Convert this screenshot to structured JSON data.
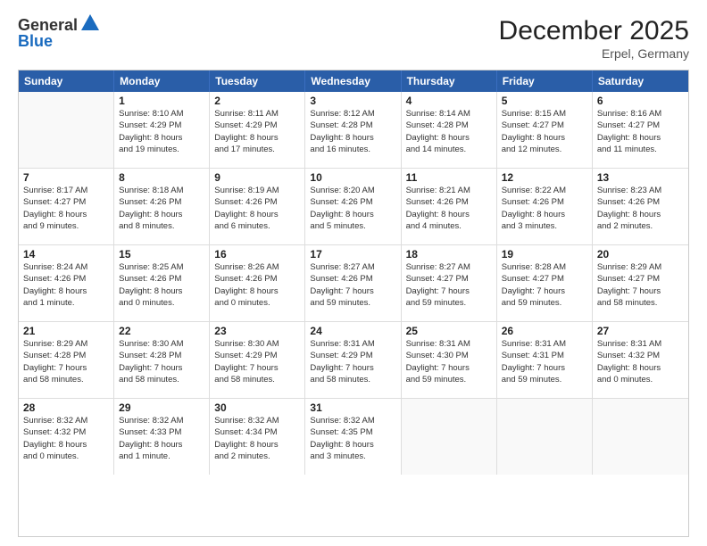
{
  "header": {
    "logo_general": "General",
    "logo_blue": "Blue",
    "month_title": "December 2025",
    "location": "Erpel, Germany"
  },
  "days_of_week": [
    "Sunday",
    "Monday",
    "Tuesday",
    "Wednesday",
    "Thursday",
    "Friday",
    "Saturday"
  ],
  "weeks": [
    [
      {
        "day": "",
        "info": ""
      },
      {
        "day": "1",
        "info": "Sunrise: 8:10 AM\nSunset: 4:29 PM\nDaylight: 8 hours\nand 19 minutes."
      },
      {
        "day": "2",
        "info": "Sunrise: 8:11 AM\nSunset: 4:29 PM\nDaylight: 8 hours\nand 17 minutes."
      },
      {
        "day": "3",
        "info": "Sunrise: 8:12 AM\nSunset: 4:28 PM\nDaylight: 8 hours\nand 16 minutes."
      },
      {
        "day": "4",
        "info": "Sunrise: 8:14 AM\nSunset: 4:28 PM\nDaylight: 8 hours\nand 14 minutes."
      },
      {
        "day": "5",
        "info": "Sunrise: 8:15 AM\nSunset: 4:27 PM\nDaylight: 8 hours\nand 12 minutes."
      },
      {
        "day": "6",
        "info": "Sunrise: 8:16 AM\nSunset: 4:27 PM\nDaylight: 8 hours\nand 11 minutes."
      }
    ],
    [
      {
        "day": "7",
        "info": "Sunrise: 8:17 AM\nSunset: 4:27 PM\nDaylight: 8 hours\nand 9 minutes."
      },
      {
        "day": "8",
        "info": "Sunrise: 8:18 AM\nSunset: 4:26 PM\nDaylight: 8 hours\nand 8 minutes."
      },
      {
        "day": "9",
        "info": "Sunrise: 8:19 AM\nSunset: 4:26 PM\nDaylight: 8 hours\nand 6 minutes."
      },
      {
        "day": "10",
        "info": "Sunrise: 8:20 AM\nSunset: 4:26 PM\nDaylight: 8 hours\nand 5 minutes."
      },
      {
        "day": "11",
        "info": "Sunrise: 8:21 AM\nSunset: 4:26 PM\nDaylight: 8 hours\nand 4 minutes."
      },
      {
        "day": "12",
        "info": "Sunrise: 8:22 AM\nSunset: 4:26 PM\nDaylight: 8 hours\nand 3 minutes."
      },
      {
        "day": "13",
        "info": "Sunrise: 8:23 AM\nSunset: 4:26 PM\nDaylight: 8 hours\nand 2 minutes."
      }
    ],
    [
      {
        "day": "14",
        "info": "Sunrise: 8:24 AM\nSunset: 4:26 PM\nDaylight: 8 hours\nand 1 minute."
      },
      {
        "day": "15",
        "info": "Sunrise: 8:25 AM\nSunset: 4:26 PM\nDaylight: 8 hours\nand 0 minutes."
      },
      {
        "day": "16",
        "info": "Sunrise: 8:26 AM\nSunset: 4:26 PM\nDaylight: 8 hours\nand 0 minutes."
      },
      {
        "day": "17",
        "info": "Sunrise: 8:27 AM\nSunset: 4:26 PM\nDaylight: 7 hours\nand 59 minutes."
      },
      {
        "day": "18",
        "info": "Sunrise: 8:27 AM\nSunset: 4:27 PM\nDaylight: 7 hours\nand 59 minutes."
      },
      {
        "day": "19",
        "info": "Sunrise: 8:28 AM\nSunset: 4:27 PM\nDaylight: 7 hours\nand 59 minutes."
      },
      {
        "day": "20",
        "info": "Sunrise: 8:29 AM\nSunset: 4:27 PM\nDaylight: 7 hours\nand 58 minutes."
      }
    ],
    [
      {
        "day": "21",
        "info": "Sunrise: 8:29 AM\nSunset: 4:28 PM\nDaylight: 7 hours\nand 58 minutes."
      },
      {
        "day": "22",
        "info": "Sunrise: 8:30 AM\nSunset: 4:28 PM\nDaylight: 7 hours\nand 58 minutes."
      },
      {
        "day": "23",
        "info": "Sunrise: 8:30 AM\nSunset: 4:29 PM\nDaylight: 7 hours\nand 58 minutes."
      },
      {
        "day": "24",
        "info": "Sunrise: 8:31 AM\nSunset: 4:29 PM\nDaylight: 7 hours\nand 58 minutes."
      },
      {
        "day": "25",
        "info": "Sunrise: 8:31 AM\nSunset: 4:30 PM\nDaylight: 7 hours\nand 59 minutes."
      },
      {
        "day": "26",
        "info": "Sunrise: 8:31 AM\nSunset: 4:31 PM\nDaylight: 7 hours\nand 59 minutes."
      },
      {
        "day": "27",
        "info": "Sunrise: 8:31 AM\nSunset: 4:32 PM\nDaylight: 8 hours\nand 0 minutes."
      }
    ],
    [
      {
        "day": "28",
        "info": "Sunrise: 8:32 AM\nSunset: 4:32 PM\nDaylight: 8 hours\nand 0 minutes."
      },
      {
        "day": "29",
        "info": "Sunrise: 8:32 AM\nSunset: 4:33 PM\nDaylight: 8 hours\nand 1 minute."
      },
      {
        "day": "30",
        "info": "Sunrise: 8:32 AM\nSunset: 4:34 PM\nDaylight: 8 hours\nand 2 minutes."
      },
      {
        "day": "31",
        "info": "Sunrise: 8:32 AM\nSunset: 4:35 PM\nDaylight: 8 hours\nand 3 minutes."
      },
      {
        "day": "",
        "info": ""
      },
      {
        "day": "",
        "info": ""
      },
      {
        "day": "",
        "info": ""
      }
    ]
  ]
}
